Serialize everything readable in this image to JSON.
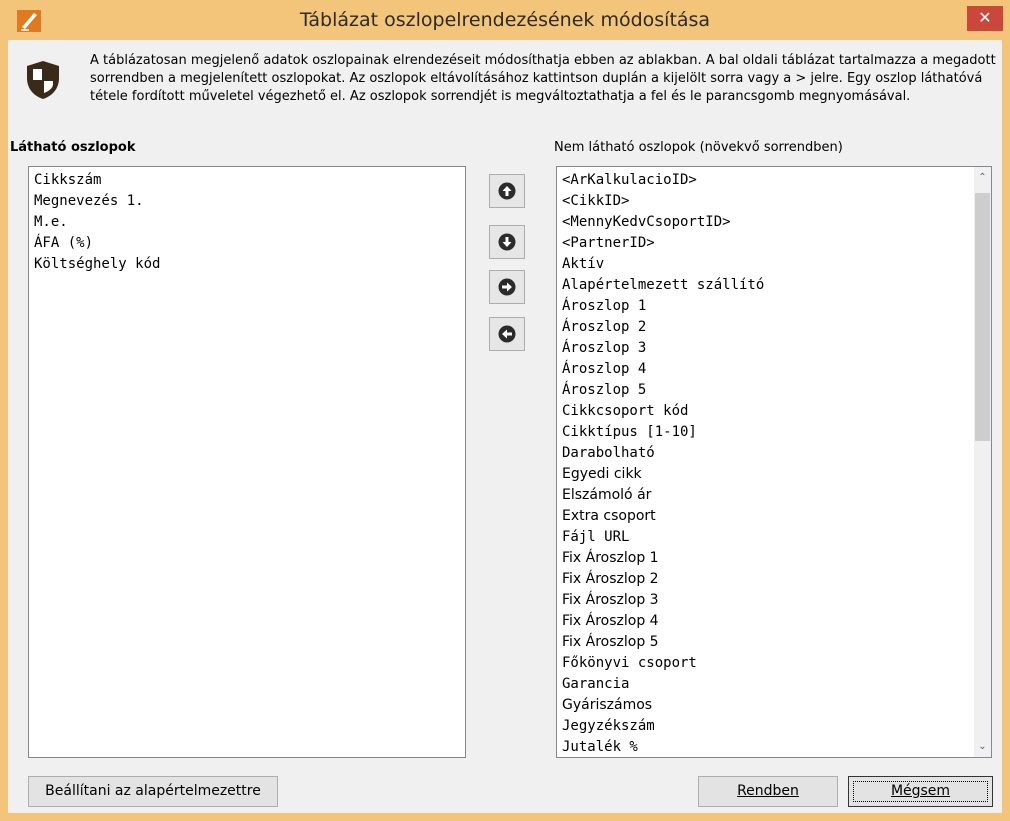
{
  "window": {
    "title": "Táblázat oszlopelrendezésének módosítása",
    "close_label": "✕",
    "accent_color": "#f3c57a",
    "close_color": "#c9483b"
  },
  "info": {
    "text": "A táblázatosan megjelenő adatok oszlopainak elrendezéseit módosíthatja ebben az ablakban. A bal oldali táblázat tartalmazza a megadott sorrendben a megjelenített oszlopokat. Az oszlopok eltávolításához kattintson duplán a kijelölt sorra vagy a > jelre. Egy oszlop láthatóvá tétele fordított műveletel végezhető el. Az oszlopok sorrendjét is megváltoztathatja a fel és le parancsgomb megnyomásával."
  },
  "visible_columns": {
    "label": "Látható oszlopok",
    "items": [
      "Cikkszám",
      "Megnevezés 1.",
      "M.e.",
      "ÁFA (%)",
      "Költséghely kód"
    ]
  },
  "hidden_columns": {
    "label": "Nem látható oszlopok (növekvő sorrendben)",
    "items": [
      "<ArKalkulacioID>",
      "<CikkID>",
      "<MennyKedvCsoportID>",
      "<PartnerID>",
      "Aktív",
      "Alapértelmezett szállító",
      "Ároszlop 1",
      "Ároszlop 2",
      "Ároszlop 3",
      "Ároszlop 4",
      "Ároszlop 5",
      "Cikkcsoport kód",
      "Cikktípus [1-10]",
      "Darabolható",
      "Egyedi cikk",
      "Elszámoló ár",
      "Extra csoport",
      "Fájl URL",
      "Fix Ároszlop 1",
      "Fix Ároszlop 2",
      "Fix Ároszlop 3",
      "Fix Ároszlop 4",
      "Fix Ároszlop 5",
      "Főkönyvi csoport",
      "Garancia",
      "Gyáriszámos",
      "Jegyzékszám",
      "Jutalék %"
    ]
  },
  "buttons": {
    "reset": "Beállítani az alapértelmezettre",
    "ok": "Rendben",
    "cancel": "Mégsem"
  },
  "icons": {
    "app": "edit-icon",
    "shield": "shield-icon",
    "up": "arrow-up-circle-icon",
    "down": "arrow-down-circle-icon",
    "right": "arrow-right-circle-icon",
    "left": "arrow-left-circle-icon"
  }
}
